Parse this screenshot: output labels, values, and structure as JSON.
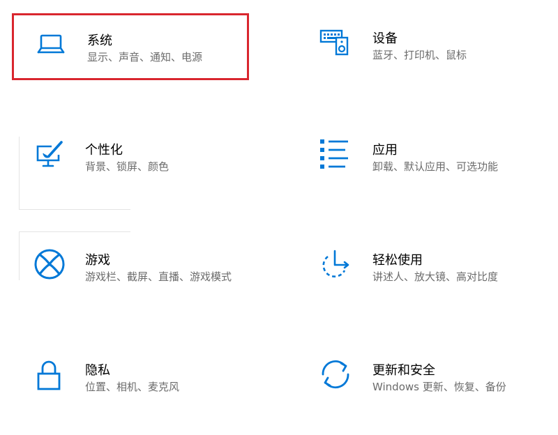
{
  "colors": {
    "accent": "#0078d7",
    "selection": "#d9262e",
    "title_text": "#000000",
    "sub_text": "#6b6b6b"
  },
  "tiles": [
    {
      "title": "系统",
      "subtitle": "显示、声音、通知、电源",
      "icon": "laptop-icon",
      "selected": true
    },
    {
      "title": "设备",
      "subtitle": "蓝牙、打印机、鼠标",
      "icon": "keyboard-speaker-icon",
      "selected": false
    },
    {
      "title": "个性化",
      "subtitle": "背景、锁屏、颜色",
      "icon": "paint-monitor-icon",
      "selected": false
    },
    {
      "title": "应用",
      "subtitle": "卸载、默认应用、可选功能",
      "icon": "app-list-icon",
      "selected": false
    },
    {
      "title": "游戏",
      "subtitle": "游戏栏、截屏、直播、游戏模式",
      "icon": "xbox-icon",
      "selected": false
    },
    {
      "title": "轻松使用",
      "subtitle": "讲述人、放大镜、高对比度",
      "icon": "ease-of-access-icon",
      "selected": false
    },
    {
      "title": "隐私",
      "subtitle": "位置、相机、麦克风",
      "icon": "lock-icon",
      "selected": false
    },
    {
      "title": "更新和安全",
      "subtitle": "Windows 更新、恢复、备份",
      "icon": "sync-icon",
      "selected": false
    }
  ]
}
